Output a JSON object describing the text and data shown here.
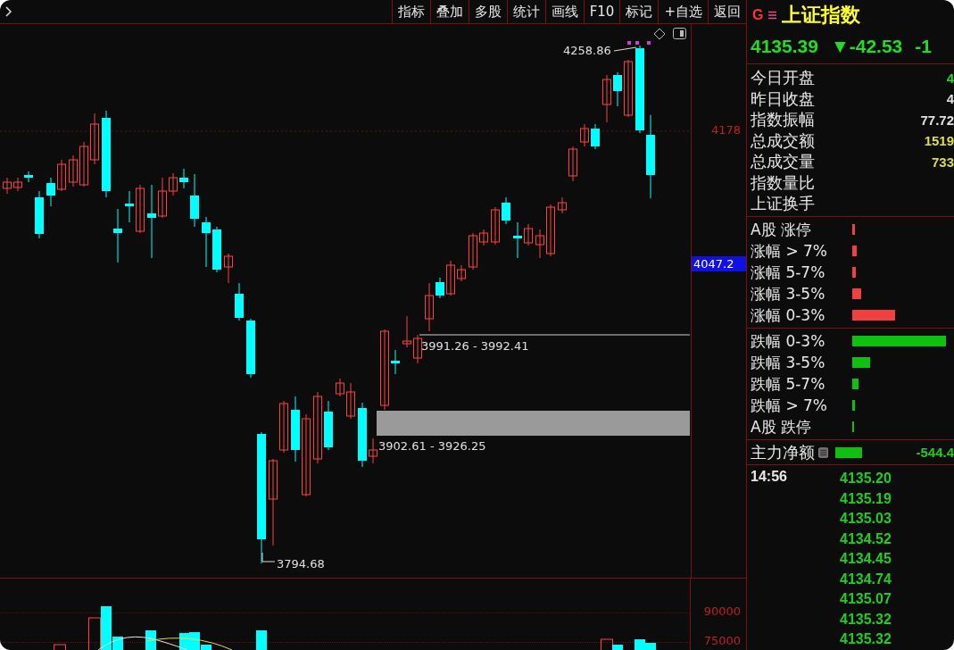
{
  "toolbar": {
    "buttons": [
      {
        "label": "指标"
      },
      {
        "label": "叠加"
      },
      {
        "label": "多股"
      },
      {
        "label": "统计"
      },
      {
        "label": "画线"
      },
      {
        "label": "F10"
      },
      {
        "label": "标记"
      },
      {
        "label": "+自选"
      },
      {
        "label": "返回"
      }
    ]
  },
  "chart": {
    "annotations": [
      {
        "kind": "high",
        "text": "4258.86"
      },
      {
        "kind": "low",
        "text": "3794.68"
      },
      {
        "kind": "range_upper",
        "text": "3991.26 - 3992.41"
      },
      {
        "kind": "range_lower",
        "text": "3902.61 - 3926.25"
      }
    ],
    "price_axis": {
      "tick": "4178",
      "cursor": "4047.2"
    },
    "volume_axis": {
      "ticks": [
        "90000",
        "75000"
      ]
    }
  },
  "quote": {
    "badge": "G",
    "name": "上证指数",
    "price": "4135.39",
    "change": "▼-42.53",
    "change_pct": "-1",
    "stats": [
      {
        "label": "今日开盘",
        "value": "4",
        "color": "#22dd22"
      },
      {
        "label": "昨日收盘",
        "value": "4",
        "color": "#e0e0e0"
      },
      {
        "label": "指数振幅",
        "value": "77.72",
        "color": "#e0e0e0"
      },
      {
        "label": "总成交额",
        "value": "1519",
        "color": "#dede44"
      },
      {
        "label": "总成交量",
        "value": "733",
        "color": "#dede44"
      },
      {
        "label": "指数量比"
      },
      {
        "label": "上证换手"
      }
    ],
    "rise_distribution": [
      {
        "label": "A股 涨停"
      },
      {
        "label": "涨幅 > 7%"
      },
      {
        "label": "涨幅 5-7%"
      },
      {
        "label": "涨幅 3-5%"
      },
      {
        "label": "涨幅 0-3%"
      }
    ],
    "fall_distribution": [
      {
        "label": "跌幅 0-3%"
      },
      {
        "label": "跌幅 3-5%"
      },
      {
        "label": "跌幅 5-7%"
      },
      {
        "label": "跌幅 > 7%"
      },
      {
        "label": "A股 跌停"
      }
    ],
    "main_net": {
      "label": "主力净额",
      "value": "-544.4"
    },
    "ticks": {
      "time": "14:56",
      "prices": [
        "4135.20",
        "4135.19",
        "4135.03",
        "4134.52",
        "4134.45",
        "4134.74",
        "4135.07",
        "4135.32",
        "4135.32"
      ]
    }
  }
}
